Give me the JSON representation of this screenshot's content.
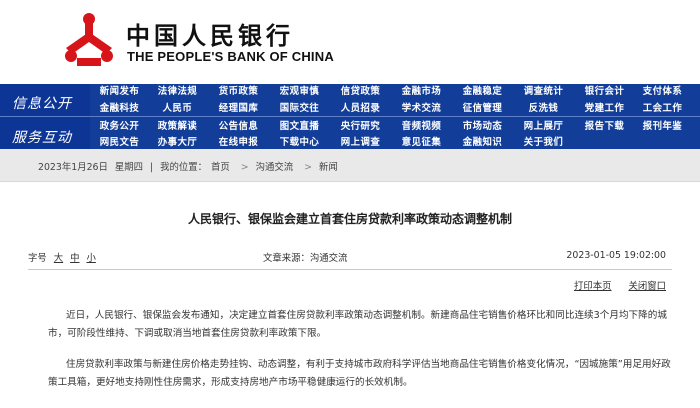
{
  "header": {
    "logo_cn": "中国人民银行",
    "logo_en": "THE PEOPLE'S BANK OF CHINA",
    "brand_red": "#d7141a",
    "nav_blue": "#123e9a"
  },
  "nav": {
    "section1_title": "信息公开",
    "section2_title": "服务互动",
    "rows": [
      [
        "新闻发布",
        "法律法规",
        "货币政策",
        "宏观审慎",
        "信贷政策",
        "金融市场",
        "金融稳定",
        "调查统计",
        "银行会计",
        "支付体系"
      ],
      [
        "金融科技",
        "人民币",
        "经理国库",
        "国际交往",
        "人员招录",
        "学术交流",
        "征信管理",
        "反洗钱",
        "党建工作",
        "工会工作"
      ],
      [
        "政务公开",
        "政策解读",
        "公告信息",
        "图文直播",
        "央行研究",
        "音频视频",
        "市场动态",
        "网上展厅",
        "报告下载",
        "报刊年鉴"
      ],
      [
        "网民文告",
        "办事大厅",
        "在线申报",
        "下载中心",
        "网上调查",
        "意见征集",
        "金融知识",
        "关于我们"
      ]
    ]
  },
  "breadcrumb": {
    "date": "2023年1月26日",
    "weekday": "星期四",
    "location_label": "我的位置：",
    "home": "首页",
    "section": "沟通交流",
    "current": "新闻",
    "sep": ">"
  },
  "article": {
    "title": "人民银行、银保监会建立首套住房贷款利率政策动态调整机制",
    "font_label": "字号",
    "font_large": "大",
    "font_medium": "中",
    "font_small": "小",
    "source": "文章来源：沟通交流",
    "date": "2023-01-05  19:02:00",
    "print_label": "打印本页",
    "close_label": "关闭窗口",
    "paragraphs": [
      "近日，人民银行、银保监会发布通知，决定建立首套住房贷款利率政策动态调整机制。新建商品住宅销售价格环比和同比连续3个月均下降的城市，可阶段性维持、下调或取消当地首套住房贷款利率政策下限。",
      "住房贷款利率政策与新建住房价格走势挂钩、动态调整，有利于支持城市政府科学评估当地商品住宅销售价格变化情况，“因城施策”用足用好政策工具箱，更好地支持刚性住房需求，形成支持房地产市场平稳健康运行的长效机制。"
    ]
  }
}
